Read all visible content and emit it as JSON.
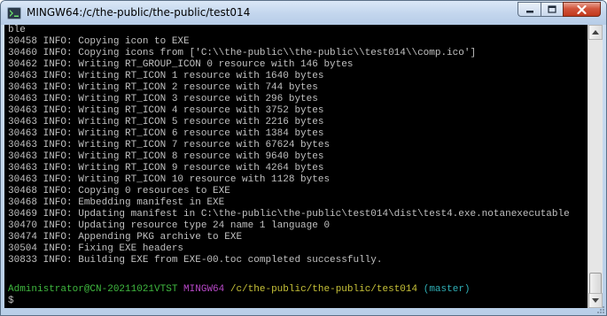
{
  "window": {
    "title": "MINGW64:/c/the-public/the-public/test014"
  },
  "terminal": {
    "lines": [
      "ble",
      "30458 INFO: Copying icon to EXE",
      "30460 INFO: Copying icons from ['C:\\\\the-public\\\\the-public\\\\test014\\\\comp.ico']",
      "30462 INFO: Writing RT_GROUP_ICON 0 resource with 146 bytes",
      "30463 INFO: Writing RT_ICON 1 resource with 1640 bytes",
      "30463 INFO: Writing RT_ICON 2 resource with 744 bytes",
      "30463 INFO: Writing RT_ICON 3 resource with 296 bytes",
      "30463 INFO: Writing RT_ICON 4 resource with 3752 bytes",
      "30463 INFO: Writing RT_ICON 5 resource with 2216 bytes",
      "30463 INFO: Writing RT_ICON 6 resource with 1384 bytes",
      "30463 INFO: Writing RT_ICON 7 resource with 67624 bytes",
      "30463 INFO: Writing RT_ICON 8 resource with 9640 bytes",
      "30463 INFO: Writing RT_ICON 9 resource with 4264 bytes",
      "30463 INFO: Writing RT_ICON 10 resource with 1128 bytes",
      "30468 INFO: Copying 0 resources to EXE",
      "30468 INFO: Embedding manifest in EXE",
      "30469 INFO: Updating manifest in C:\\the-public\\the-public\\test014\\dist\\test4.exe.notanexecutable",
      "30470 INFO: Updating resource type 24 name 1 language 0",
      "30474 INFO: Appending PKG archive to EXE",
      "30504 INFO: Fixing EXE headers",
      "30833 INFO: Building EXE from EXE-00.toc completed successfully."
    ],
    "prompt": {
      "user_host": "Administrator@CN-20211021VTST",
      "system": "MINGW64",
      "path": "/c/the-public/the-public/test014",
      "branch": "(master)",
      "symbol": "$"
    }
  },
  "colors": {
    "background": "#000000",
    "text": "#c0c0c0",
    "prompt_user": "#3fb93f",
    "prompt_system": "#b848c8",
    "prompt_path": "#c7c238",
    "prompt_branch": "#2fb0b7"
  },
  "icons": {
    "app": "mingw-terminal-icon",
    "minimize": "minimize-icon",
    "maximize": "maximize-icon",
    "close": "close-icon",
    "scroll_up": "scroll-up-arrow-icon",
    "scroll_down": "scroll-down-arrow-icon"
  }
}
